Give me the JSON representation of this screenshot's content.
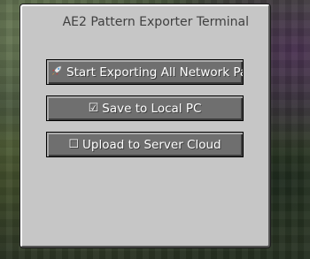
{
  "window": {
    "title": "AE2 Pattern Exporter Terminal"
  },
  "buttons": {
    "export": {
      "icon": "rocket-icon",
      "label": "Start Exporting All Network Patte"
    },
    "local": {
      "checkbox": "☑",
      "label": "Save to Local PC",
      "checked": true
    },
    "cloud": {
      "checkbox": "☐",
      "label": "Upload to Server Cloud",
      "checked": false
    }
  },
  "colors": {
    "panel": "#c6c6c6",
    "button": "#6f6f6f",
    "title_text": "#3f3f3f",
    "button_text": "#ffffff"
  }
}
